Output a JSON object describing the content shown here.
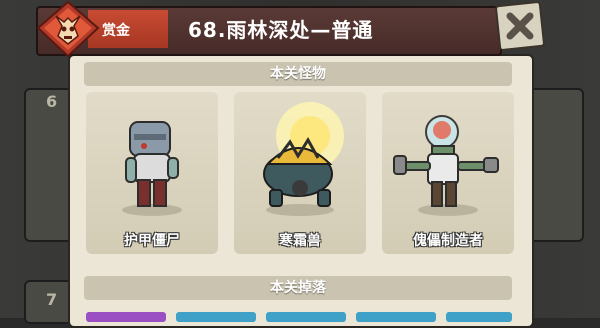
{
  "header": {
    "bounty_label": "赏金",
    "title": "68.雨林深处—普通"
  },
  "sections": {
    "monsters_title": "本关怪物",
    "drops_title": "本关掉落"
  },
  "monsters": [
    {
      "name": "护甲僵尸"
    },
    {
      "name": "寒霜兽"
    },
    {
      "name": "傀儡制造者"
    }
  ],
  "background": {
    "left_level_1": "6",
    "left_level_2": "7"
  },
  "colors": {
    "bounty_tab": "#c94b33",
    "panel_bg": "#ebe6d6",
    "section_header_bg": "#c9c3b0",
    "header_bg": "#5a3a36"
  },
  "icons": {
    "emblem": "demon-skull-emblem",
    "close": "close-x-icon"
  }
}
